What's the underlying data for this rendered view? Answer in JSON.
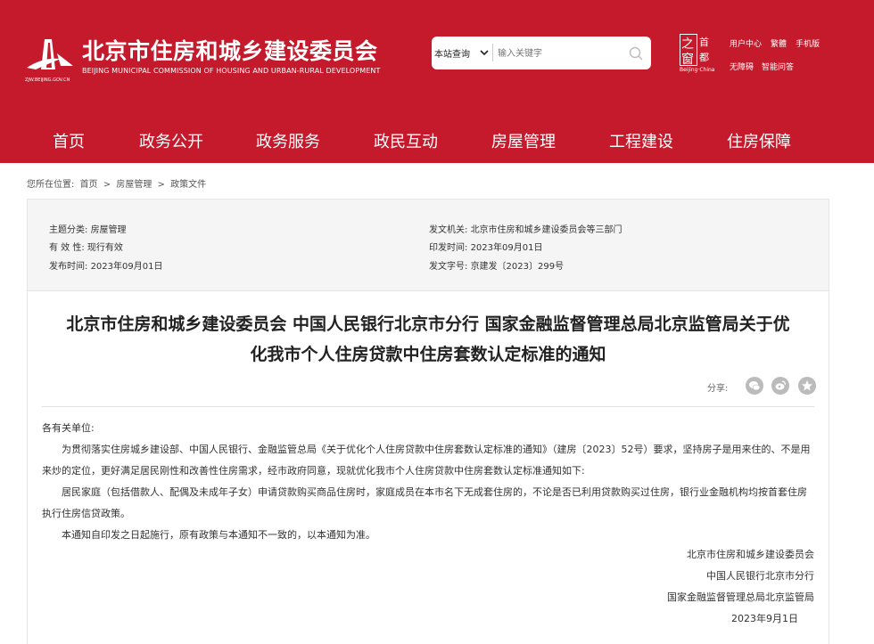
{
  "header": {
    "site_title": "北京市住房和城乡建设委员会",
    "site_subtitle": "BEIJING MUNICIPAL COMMISSION OF HOUSING AND URBAN-RURAL DEVELOPMENT",
    "logo_caption": "ZJW.BEIJING.GOV.CN",
    "search": {
      "scope": "本站查询",
      "placeholder": "输入关键字"
    },
    "capital_logo": {
      "chars": [
        "之",
        "首",
        "窗",
        "都"
      ],
      "caption": "Beijing·China"
    },
    "top_links": [
      "用户中心",
      "繁體",
      "手机版",
      "无障碍",
      "智能问答"
    ]
  },
  "nav": {
    "items": [
      "首页",
      "政务公开",
      "政务服务",
      "政民互动",
      "房屋管理",
      "工程建设",
      "住房保障"
    ]
  },
  "breadcrumb": {
    "prefix": "您所在位置:",
    "items": [
      "首页",
      "房屋管理",
      "政策文件"
    ],
    "separator": ">"
  },
  "meta": {
    "topic_label": "主题分类:",
    "topic": "房屋管理",
    "validity_label": "有 效 性:",
    "validity": "现行有效",
    "publish_date_label": "发布时间:",
    "publish_date": "2023年09月01日",
    "issuer_label": "发文机关:",
    "issuer": "北京市住房和城乡建设委员会等三部门",
    "issue_date_label": "印发时间:",
    "issue_date": "2023年09月01日",
    "doc_no_label": "发文字号:",
    "doc_no": "京建发〔2023〕299号"
  },
  "article": {
    "title_line1": "北京市住房和城乡建设委员会 中国人民银行北京市分行 国家金融监督管理总局北京监管局关于优",
    "title_line2": "化我市个人住房贷款中住房套数认定标准的通知",
    "share_label": "分享:",
    "salutation": "各有关单位:",
    "paragraph1": "为贯彻落实住房城乡建设部、中国人民银行、金融监管总局《关于优化个人住房贷款中住房套数认定标准的通知》（建房〔2023〕52号）要求，坚持房子是用来住的、不是用来炒的定位，更好满足居民刚性和改善性住房需求，经市政府同意，现就优化我市个人住房贷款中住房套数认定标准通知如下:",
    "paragraph2": "居民家庭（包括借款人、配偶及未成年子女）申请贷款购买商品住房时，家庭成员在本市名下无成套住房的，不论是否已利用贷款购买过住房，银行业金融机构均按首套住房执行住房信贷政策。",
    "paragraph3": "本通知自印发之日起施行，原有政策与本通知不一致的，以本通知为准。",
    "signatures": [
      "北京市住房和城乡建设委员会",
      "中国人民银行北京市分行",
      "国家金融监督管理总局北京监管局"
    ],
    "sign_date": "2023年9月1日"
  },
  "colors": {
    "brand_red": "#c41a2c",
    "meta_bg": "#f5f5f5"
  },
  "icons": [
    "logo-emblem",
    "chevron-down-icon",
    "search-icon",
    "wechat-icon",
    "weibo-icon",
    "star-icon"
  ]
}
